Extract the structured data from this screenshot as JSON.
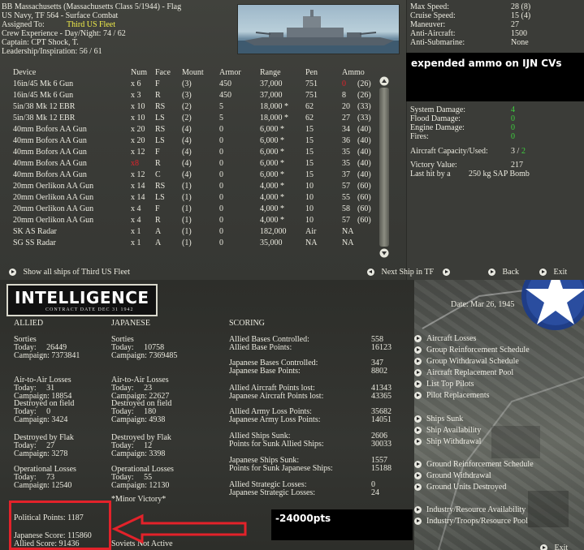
{
  "ship": {
    "name": "BB Massachusetts (Massachusetts Class 5/1944) - Flag",
    "navy": "US Navy, TF 564 - Surface Combat",
    "assigned_label": "Assigned To:",
    "assigned_value": "Third US Fleet",
    "crew": "Crew Experience - Day/Night: 74 / 62",
    "captain": "Captain: CPT Shock, T.",
    "leadership": "Leadership/Inspiration: 56 / 61"
  },
  "stats": [
    {
      "label": "Max Speed:",
      "value": "28 (8)"
    },
    {
      "label": "Cruise Speed:",
      "value": "15 (4)"
    },
    {
      "label": "Maneuver:",
      "value": "27"
    },
    {
      "label": "Anti-Aircraft:",
      "value": "1500"
    },
    {
      "label": "Anti-Submarine:",
      "value": "None"
    }
  ],
  "annotation_top": "expended ammo on IJN CVs",
  "damage": [
    {
      "label": "System Damage:",
      "value": "4"
    },
    {
      "label": "Flood Damage:",
      "value": "0"
    },
    {
      "label": "Engine Damage:",
      "value": "0"
    },
    {
      "label": "Fires:",
      "value": "0"
    }
  ],
  "aircraft_capacity": {
    "label": "Aircraft Capacity/Used:",
    "capacity": "3 /",
    "used": "2"
  },
  "victory": {
    "label": "Victory Value:",
    "value": "217"
  },
  "last_hit": {
    "label": "Last hit by a",
    "value": "250 kg SAP Bomb"
  },
  "device_headers": {
    "device": "Device",
    "num": "Num",
    "face": "Face",
    "mount": "Mount",
    "armor": "Armor",
    "range": "Range",
    "pen": "Pen",
    "ammo": "Ammo"
  },
  "devices": [
    {
      "device": "16in/45 Mk 6 Gun",
      "num": "x 6",
      "face": "F",
      "mount": "(3)",
      "armor": "450",
      "range": "37,000",
      "pen": "751",
      "ammo": "0",
      "ammo_max": "(26)",
      "num_red": false,
      "ammo_red": true
    },
    {
      "device": "16in/45 Mk 6 Gun",
      "num": "x 3",
      "face": "R",
      "mount": "(3)",
      "armor": "450",
      "range": "37,000",
      "pen": "751",
      "ammo": "8",
      "ammo_max": "(26)",
      "num_red": false,
      "ammo_red": false
    },
    {
      "device": "5in/38 Mk 12 EBR",
      "num": "x 10",
      "face": "RS",
      "mount": "(2)",
      "armor": "5",
      "range": "18,000 *",
      "pen": "62",
      "ammo": "20",
      "ammo_max": "(33)",
      "num_red": false,
      "ammo_red": false
    },
    {
      "device": "5in/38 Mk 12 EBR",
      "num": "x 10",
      "face": "LS",
      "mount": "(2)",
      "armor": "5",
      "range": "18,000 *",
      "pen": "62",
      "ammo": "27",
      "ammo_max": "(33)",
      "num_red": false,
      "ammo_red": false
    },
    {
      "device": "40mm Bofors AA Gun",
      "num": "x 20",
      "face": "RS",
      "mount": "(4)",
      "armor": "0",
      "range": "6,000 *",
      "pen": "15",
      "ammo": "34",
      "ammo_max": "(40)",
      "num_red": false,
      "ammo_red": false
    },
    {
      "device": "40mm Bofors AA Gun",
      "num": "x 20",
      "face": "LS",
      "mount": "(4)",
      "armor": "0",
      "range": "6,000 *",
      "pen": "15",
      "ammo": "36",
      "ammo_max": "(40)",
      "num_red": false,
      "ammo_red": false
    },
    {
      "device": "40mm Bofors AA Gun",
      "num": "x 12",
      "face": "F",
      "mount": "(4)",
      "armor": "0",
      "range": "6,000 *",
      "pen": "15",
      "ammo": "35",
      "ammo_max": "(40)",
      "num_red": false,
      "ammo_red": false
    },
    {
      "device": "40mm Bofors AA Gun",
      "num": "x8",
      "face": "R",
      "mount": "(4)",
      "armor": "0",
      "range": "6,000 *",
      "pen": "15",
      "ammo": "35",
      "ammo_max": "(40)",
      "num_red": true,
      "ammo_red": false
    },
    {
      "device": "40mm Bofors AA Gun",
      "num": "x 12",
      "face": "C",
      "mount": "(4)",
      "armor": "0",
      "range": "6,000 *",
      "pen": "15",
      "ammo": "37",
      "ammo_max": "(40)",
      "num_red": false,
      "ammo_red": false
    },
    {
      "device": "20mm Oerlikon AA Gun",
      "num": "x 14",
      "face": "RS",
      "mount": "(1)",
      "armor": "0",
      "range": "4,000 *",
      "pen": "10",
      "ammo": "57",
      "ammo_max": "(60)",
      "num_red": false,
      "ammo_red": false
    },
    {
      "device": "20mm Oerlikon AA Gun",
      "num": "x 14",
      "face": "LS",
      "mount": "(1)",
      "armor": "0",
      "range": "4,000 *",
      "pen": "10",
      "ammo": "55",
      "ammo_max": "(60)",
      "num_red": false,
      "ammo_red": false
    },
    {
      "device": "20mm Oerlikon AA Gun",
      "num": "x 4",
      "face": "F",
      "mount": "(1)",
      "armor": "0",
      "range": "4,000 *",
      "pen": "10",
      "ammo": "58",
      "ammo_max": "(60)",
      "num_red": false,
      "ammo_red": false
    },
    {
      "device": "20mm Oerlikon AA Gun",
      "num": "x 4",
      "face": "R",
      "mount": "(1)",
      "armor": "0",
      "range": "4,000 *",
      "pen": "10",
      "ammo": "57",
      "ammo_max": "(60)",
      "num_red": false,
      "ammo_red": false
    },
    {
      "device": "SK AS Radar",
      "num": "x 1",
      "face": "A",
      "mount": "(1)",
      "armor": "0",
      "range": "182,000",
      "pen": "Air",
      "ammo": "NA",
      "ammo_max": "",
      "num_red": false,
      "ammo_red": false
    },
    {
      "device": "SG SS Radar",
      "num": "x 1",
      "face": "A",
      "mount": "(1)",
      "armor": "0",
      "range": "35,000",
      "pen": "NA",
      "ammo": "NA",
      "ammo_max": "",
      "num_red": false,
      "ammo_red": false
    }
  ],
  "bottom_nav": {
    "show_all": "Show all ships of Third US Fleet",
    "next_ship": "Next Ship in TF",
    "back": "Back",
    "exit": "Exit"
  },
  "intel": {
    "logo_big": "INTELLIGENCE",
    "logo_small": "CONTRACT DATE DEC 31 1942",
    "date": "Date: Mar 26, 1945",
    "allied_header": "ALLIED",
    "japanese_header": "JAPANESE",
    "scoring_header": "SCORING",
    "allied": [
      {
        "title": "Sorties",
        "today": "Today:     26449",
        "campaign": "Campaign: 7373841"
      },
      {
        "title": "Air-to-Air Losses",
        "today": "Today:     31",
        "campaign": "Campaign: 18854"
      },
      {
        "title": "Destroyed on field",
        "today": "Today:     0",
        "campaign": "Campaign: 3424"
      },
      {
        "title": "Destroyed by Flak",
        "today": "Today:     27",
        "campaign": "Campaign: 3278"
      },
      {
        "title": "Operational Losses",
        "today": "Today:     73",
        "campaign": "Campaign: 12540"
      }
    ],
    "japanese": [
      {
        "title": "Sorties",
        "today": "Today:     10758",
        "campaign": "Campaign: 7369485"
      },
      {
        "title": "Air-to-Air Losses",
        "today": "Today:     23",
        "campaign": "Campaign: 22627"
      },
      {
        "title": "Destroyed on field",
        "today": "Today:     180",
        "campaign": "Campaign: 4938"
      },
      {
        "title": "Destroyed by Flak",
        "today": "Today:     12",
        "campaign": "Campaign: 3398"
      },
      {
        "title": "Operational Losses",
        "today": "Today:     55",
        "campaign": "Campaign: 12130"
      }
    ],
    "minor_victory": "*Minor Victory*",
    "scoring": [
      {
        "a": "Allied Bases Controlled:",
        "b": "Allied Base Points:",
        "va": "558",
        "vb": "16123"
      },
      {
        "a": "Japanese Bases Controlled:",
        "b": "Japanese Base Points:",
        "va": "347",
        "vb": "8802"
      },
      {
        "a": "Allied Aircraft Points lost:",
        "b": "Japanese Aircraft Points lost:",
        "va": "41343",
        "vb": "43365"
      },
      {
        "a": "Allied Army Loss Points:",
        "b": "Japanese Army Loss Points:",
        "va": "35682",
        "vb": "14051"
      },
      {
        "a": "Allied Ships Sunk:",
        "b": "Points for Sunk Allied Ships:",
        "va": "2606",
        "vb": "30033"
      },
      {
        "a": "Japanese Ships Sunk:",
        "b": "Points for Sunk Japanese Ships:",
        "va": "1557",
        "vb": "15188"
      },
      {
        "a": "Allied Strategic Losses:",
        "b": "Japanese Strategic Losses:",
        "va": "0",
        "vb": "24"
      }
    ],
    "political_points": "Political Points: 1187",
    "japanese_score": "Japanese Score: 115860",
    "allied_score": "Allied Score: 91436",
    "soviets": "Soviets Not Active",
    "annotation_pts": "-24000pts",
    "menu_groups": [
      [
        "Aircraft Losses",
        "Group Reinforcement Schedule",
        "Group Withdrawal Schedule",
        "Aircraft Replacement Pool",
        "List Top Pilots",
        "Pilot Replacements"
      ],
      [
        "Ships Sunk",
        "Ship Availability",
        "Ship Withdrawal"
      ],
      [
        "Ground Reinforcement Schedule",
        "Ground Withdrawal",
        "Ground Units Destroyed"
      ],
      [
        "Industry/Resource Availability",
        "Industry/Troops/Resource Pool"
      ]
    ],
    "exit": "Exit"
  },
  "colors": {
    "accent_yellow": "#f2ee4a",
    "ok_green": "#3fd23f",
    "alert_red": "#e3222a"
  }
}
